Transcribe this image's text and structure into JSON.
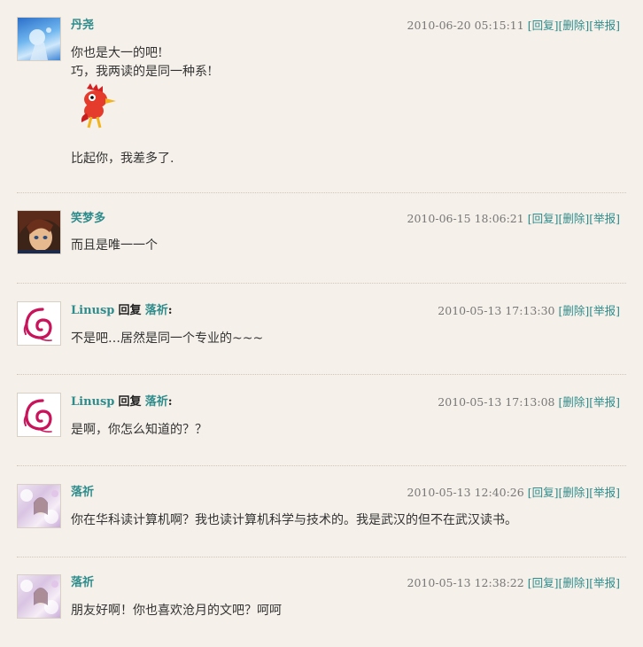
{
  "comments": [
    {
      "author": "丹尧",
      "time": "2010-06-20 05:15:11",
      "actions": [
        "[回复]",
        "[删除]",
        "[举报]"
      ],
      "lines": [
        "你也是大一的吧!",
        "巧，我两读的是同一种系!",
        "比起你，我差多了."
      ]
    },
    {
      "author": "笑梦多",
      "time": "2010-06-15 18:06:21",
      "actions": [
        "[回复]",
        "[删除]",
        "[举报]"
      ],
      "lines": [
        "而且是唯一一个"
      ]
    },
    {
      "author": "Linusp",
      "reply_word": "回复",
      "reply_target": "落祈",
      "colon": ":",
      "time": "2010-05-13 17:13:30",
      "actions": [
        "[删除]",
        "[举报]"
      ],
      "lines": [
        "不是吧…居然是同一个专业的~~~"
      ]
    },
    {
      "author": "Linusp",
      "reply_word": "回复",
      "reply_target": "落祈",
      "colon": ":",
      "time": "2010-05-13 17:13:08",
      "actions": [
        "[删除]",
        "[举报]"
      ],
      "lines": [
        "是啊，你怎么知道的？？"
      ]
    },
    {
      "author": "落祈",
      "time": "2010-05-13 12:40:26",
      "actions": [
        "[回复]",
        "[删除]",
        "[举报]"
      ],
      "lines": [
        "你在华科读计算机啊？我也读计算机科学与技术的。我是武汉的但不在武汉读书。"
      ]
    },
    {
      "author": "落祈",
      "time": "2010-05-13 12:38:22",
      "actions": [
        "[回复]",
        "[删除]",
        "[举报]"
      ],
      "lines": [
        "朋友好啊！你也喜欢沧月的文吧？呵呵"
      ]
    }
  ],
  "colors": {
    "link": "#2f8c8c",
    "background": "#f5f0e9",
    "text": "#333333"
  }
}
